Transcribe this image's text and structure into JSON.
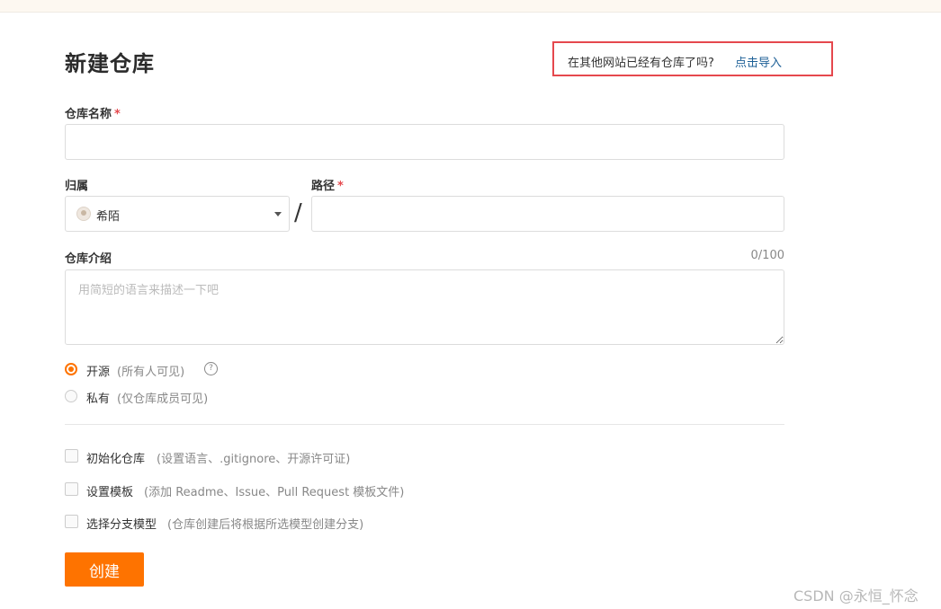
{
  "page": {
    "title": "新建仓库",
    "import_prompt": "在其他网站已经有仓库了吗?",
    "import_link": "点击导入"
  },
  "form": {
    "repo_name": {
      "label": "仓库名称",
      "required_mark": "*",
      "value": ""
    },
    "owner": {
      "label": "归属",
      "selected": "希陌"
    },
    "separator": "/",
    "path": {
      "label": "路径",
      "required_mark": "*",
      "value": ""
    },
    "description": {
      "label": "仓库介绍",
      "counter": "0/100",
      "placeholder": "用简短的语言来描述一下吧",
      "value": ""
    },
    "visibility": [
      {
        "label": "开源",
        "hint": "(所有人可见)",
        "checked": true,
        "help_icon": "question-circle-icon"
      },
      {
        "label": "私有",
        "hint": "(仅仓库成员可见)",
        "checked": false
      }
    ],
    "options": [
      {
        "label": "初始化仓库",
        "hint": "(设置语言、.gitignore、开源许可证)",
        "checked": false
      },
      {
        "label": "设置模板",
        "hint": "(添加 Readme、Issue、Pull Request 模板文件)",
        "checked": false
      },
      {
        "label": "选择分支模型",
        "hint": "(仓库创建后将根据所选模型创建分支)",
        "checked": false
      }
    ],
    "submit_label": "创建"
  },
  "watermark": "CSDN @永恒_怀念",
  "colors": {
    "accent": "#fe7300",
    "link": "#1c5f96",
    "required": "#e5484d",
    "highlight_border": "#e5484d"
  }
}
